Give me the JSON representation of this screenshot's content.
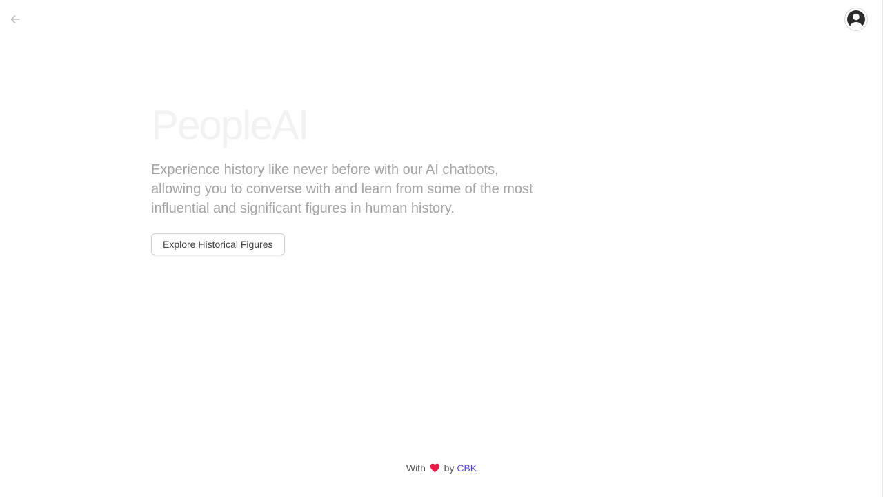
{
  "header": {
    "back_icon": "arrow-left-icon",
    "avatar_icon": "user-circle-icon"
  },
  "hero": {
    "title": "PeopleAI",
    "description": "Experience history like never before with our AI chatbots, allowing you to converse with and learn from some of the most influential and significant figures in human history.",
    "cta_label": "Explore Historical Figures"
  },
  "footer": {
    "prefix": "With",
    "heart_icon": "heart-icon",
    "middle": "by",
    "author_link": "CBK"
  },
  "colors": {
    "accent": "#4f46e5",
    "heart": "#e11d48",
    "muted_text": "#a3a3a3"
  }
}
